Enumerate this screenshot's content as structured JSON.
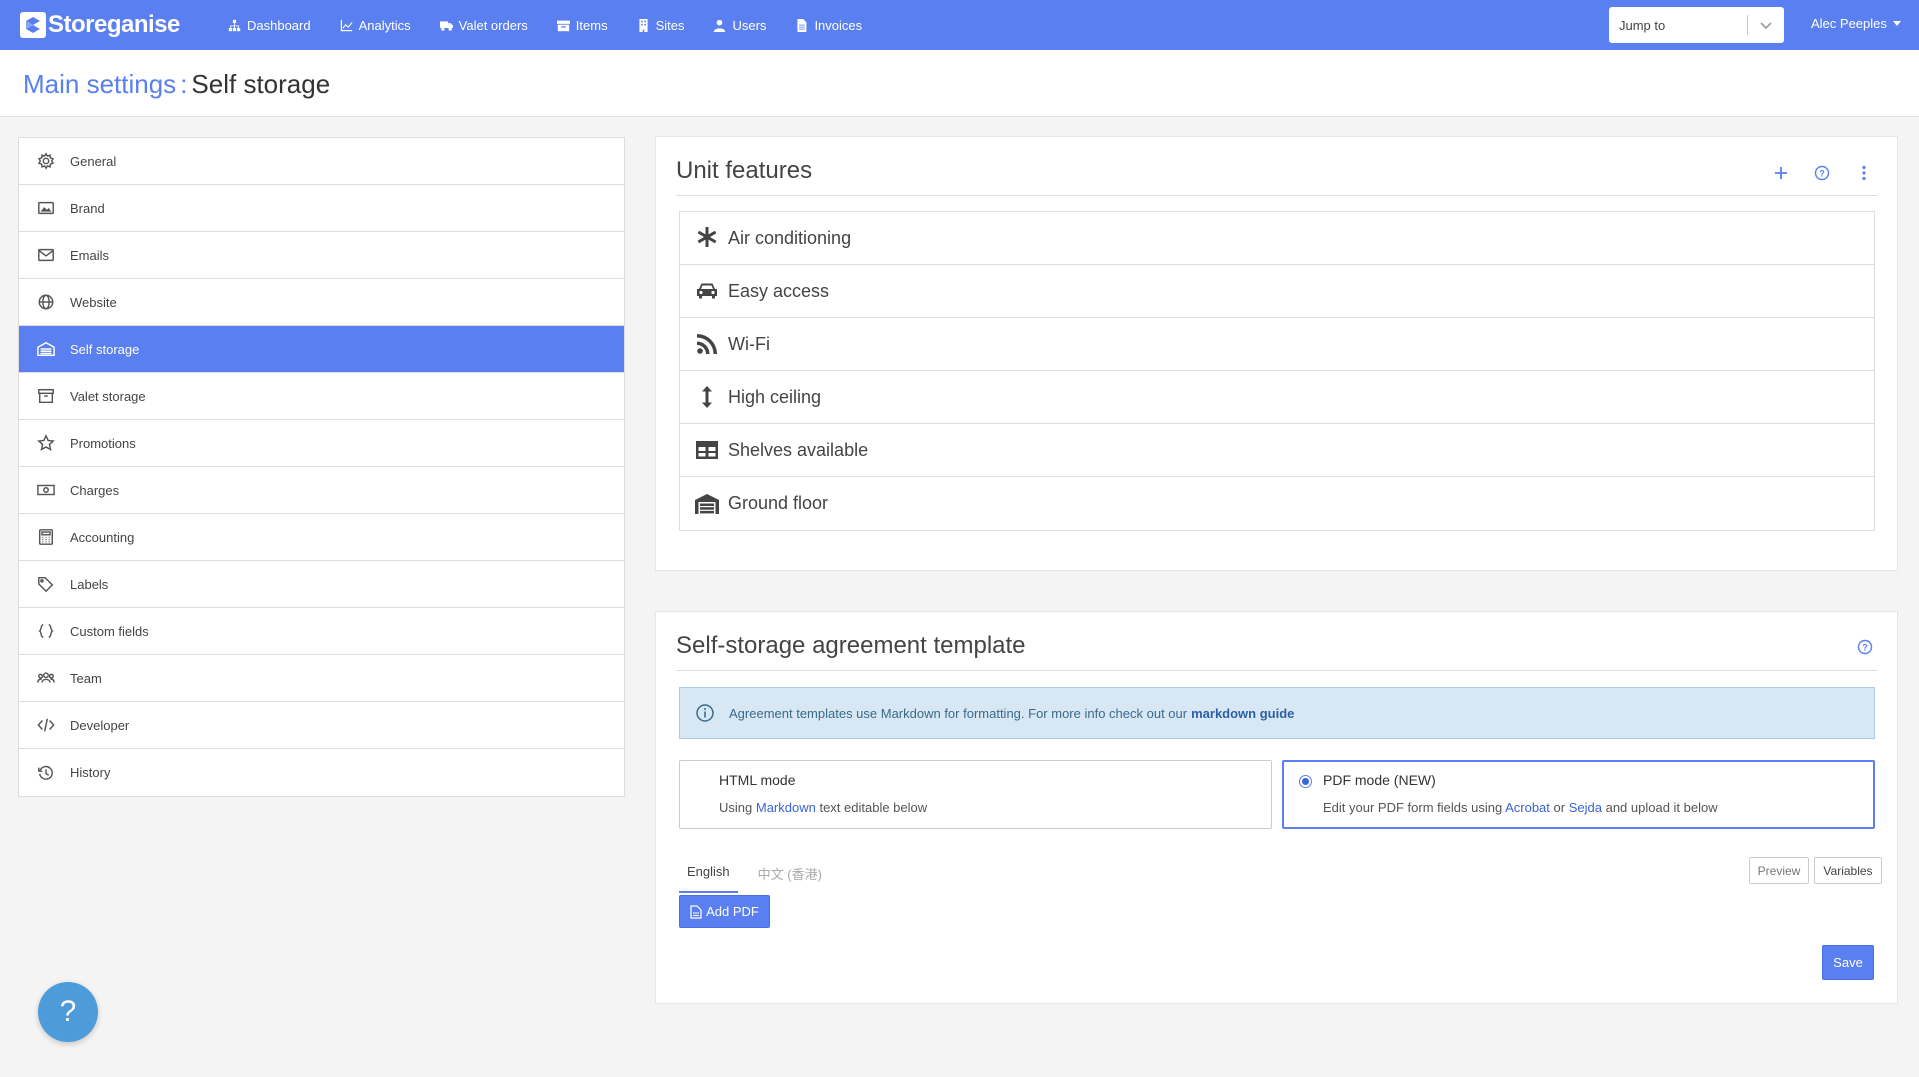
{
  "app": {
    "name": "Storeganise"
  },
  "nav": {
    "items": [
      {
        "label": "Dashboard",
        "icon": "sitemap-icon"
      },
      {
        "label": "Analytics",
        "icon": "chart-line-icon"
      },
      {
        "label": "Valet orders",
        "icon": "truck-icon"
      },
      {
        "label": "Items",
        "icon": "archive-icon"
      },
      {
        "label": "Sites",
        "icon": "building-icon"
      },
      {
        "label": "Users",
        "icon": "user-icon"
      },
      {
        "label": "Invoices",
        "icon": "file-icon"
      }
    ],
    "jump_to": "Jump to",
    "user_name": "Alec Peeples"
  },
  "breadcrumb": {
    "parent": "Main settings",
    "separator": ":",
    "current": "Self storage"
  },
  "sidebar": {
    "items": [
      {
        "label": "General",
        "icon": "gear-icon"
      },
      {
        "label": "Brand",
        "icon": "image-icon"
      },
      {
        "label": "Emails",
        "icon": "envelope-icon"
      },
      {
        "label": "Website",
        "icon": "globe-icon"
      },
      {
        "label": "Self storage",
        "icon": "warehouse-icon",
        "active": true
      },
      {
        "label": "Valet storage",
        "icon": "box-icon"
      },
      {
        "label": "Promotions",
        "icon": "star-icon"
      },
      {
        "label": "Charges",
        "icon": "money-icon"
      },
      {
        "label": "Accounting",
        "icon": "calculator-icon"
      },
      {
        "label": "Labels",
        "icon": "tags-icon"
      },
      {
        "label": "Custom fields",
        "icon": "braces-icon"
      },
      {
        "label": "Team",
        "icon": "users-icon"
      },
      {
        "label": "Developer",
        "icon": "code-icon"
      },
      {
        "label": "History",
        "icon": "history-icon"
      }
    ]
  },
  "unit_features": {
    "title": "Unit features",
    "items": [
      {
        "label": "Air conditioning",
        "icon": "asterisk-icon"
      },
      {
        "label": "Easy access",
        "icon": "car-icon"
      },
      {
        "label": "Wi-Fi",
        "icon": "rss-icon"
      },
      {
        "label": "High ceiling",
        "icon": "arrows-vertical-icon"
      },
      {
        "label": "Shelves available",
        "icon": "table-icon"
      },
      {
        "label": "Ground floor",
        "icon": "warehouse-icon"
      }
    ]
  },
  "agreement": {
    "title": "Self-storage agreement template",
    "info_text": "Agreement templates use Markdown for formatting. For more info check out our",
    "info_link": "markdown guide",
    "html_mode": {
      "title": "HTML mode",
      "desc_prefix": "Using",
      "desc_link": "Markdown",
      "desc_suffix": "text editable below"
    },
    "pdf_mode": {
      "title": "PDF mode (NEW)",
      "desc_prefix": "Edit your PDF form fields using",
      "link1": "Acrobat",
      "or": "or",
      "link2": "Sejda",
      "desc_suffix": "and upload it below",
      "selected": true
    },
    "tabs": [
      "English",
      "中文 (香港)"
    ],
    "preview_label": "Preview",
    "variables_label": "Variables",
    "add_pdf_label": "Add PDF",
    "save_label": "Save"
  },
  "help": {
    "label": "?"
  },
  "colors": {
    "primary": "#5a7ff0",
    "info_bg": "#d7e8f4",
    "help": "#4d9bd9"
  }
}
